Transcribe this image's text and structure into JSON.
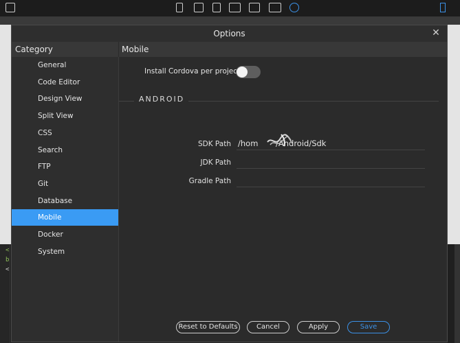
{
  "window": {
    "title": "Options",
    "close_glyph": "✕"
  },
  "headers": {
    "category": "Category",
    "section": "Mobile"
  },
  "sidebar": {
    "items": [
      {
        "label": "General"
      },
      {
        "label": "Code Editor"
      },
      {
        "label": "Design View"
      },
      {
        "label": "Split View"
      },
      {
        "label": "CSS"
      },
      {
        "label": "Search"
      },
      {
        "label": "FTP"
      },
      {
        "label": "Git"
      },
      {
        "label": "Database"
      },
      {
        "label": "Mobile",
        "selected": true
      },
      {
        "label": "Docker"
      },
      {
        "label": "System"
      }
    ]
  },
  "mobile": {
    "cordova_label": "Install Cordova per project",
    "cordova_enabled": false,
    "android_heading": "ANDROID",
    "sdk_label": "SDK Path",
    "sdk_value": "/hom       /Android/Sdk",
    "jdk_label": "JDK Path",
    "jdk_value": "",
    "gradle_label": "Gradle Path",
    "gradle_value": ""
  },
  "buttons": {
    "reset": "Reset to Defaults",
    "cancel": "Cancel",
    "apply": "Apply",
    "save": "Save"
  },
  "colors": {
    "accent": "#3a9bf4",
    "background": "#2b2b2b"
  },
  "background_code": [
    "<",
    "b",
    "<"
  ]
}
